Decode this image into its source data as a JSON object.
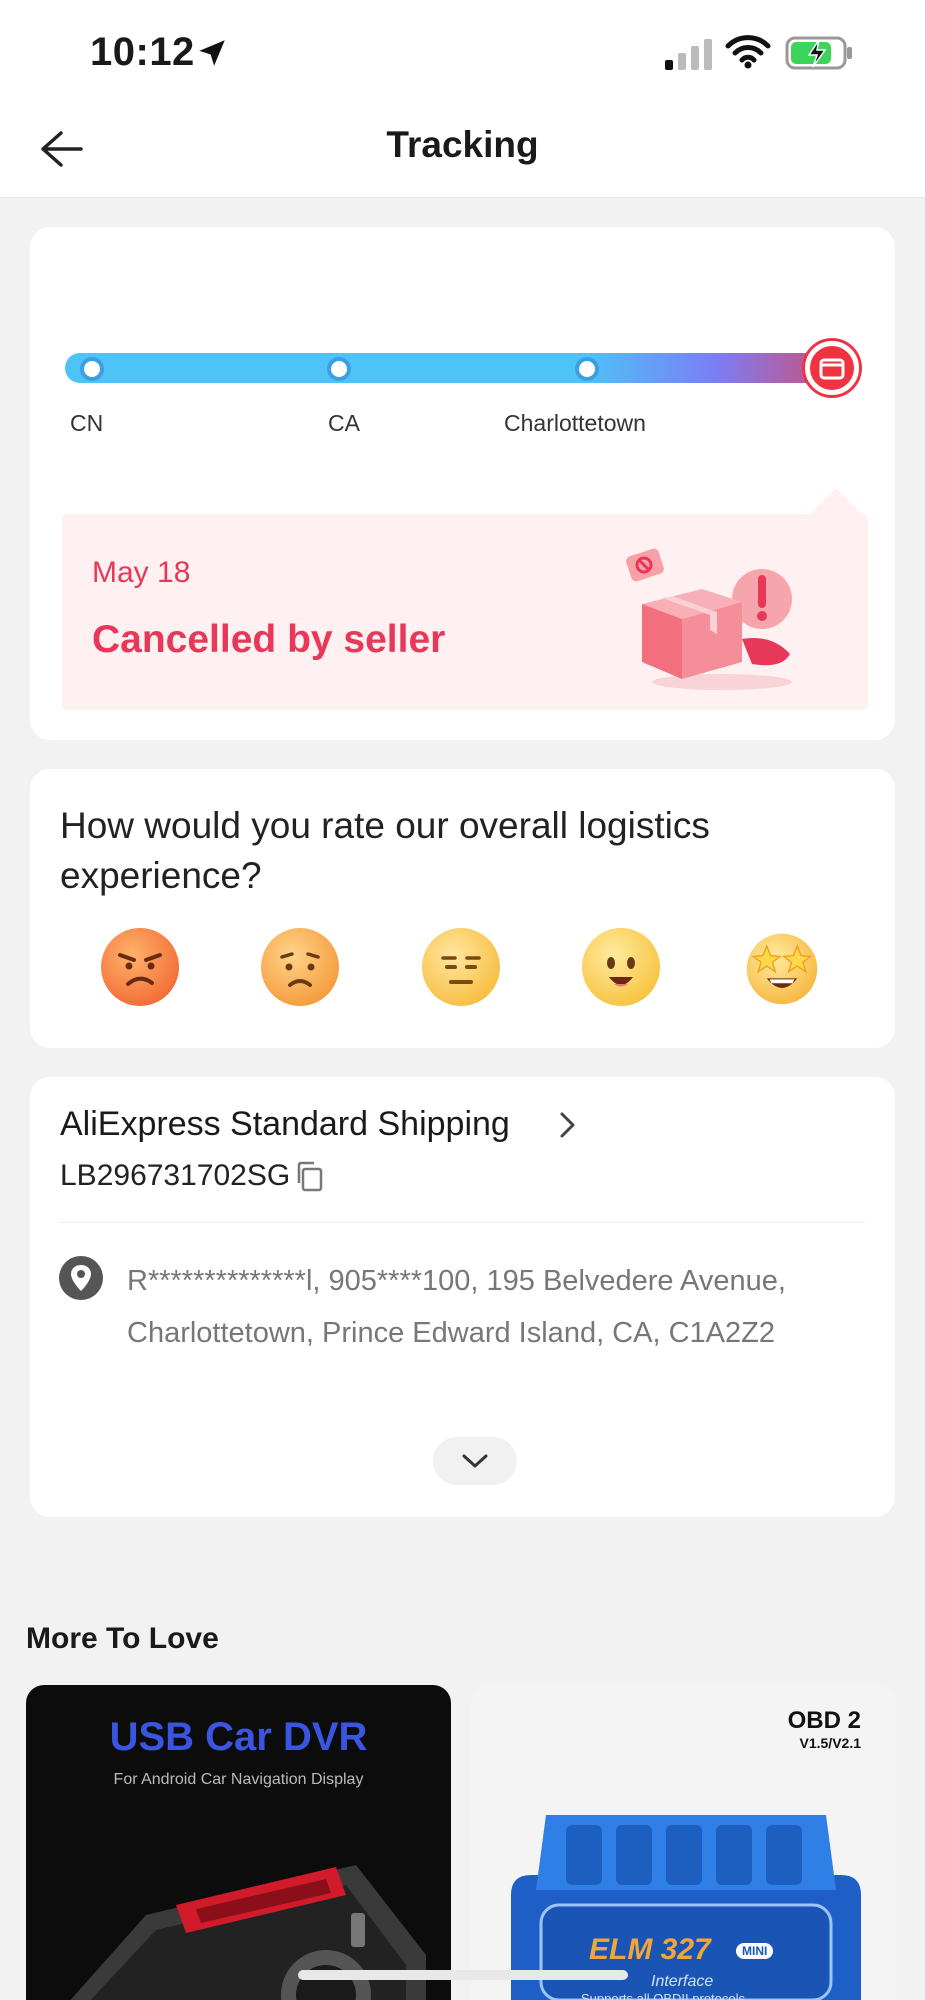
{
  "status_bar": {
    "time": "10:12"
  },
  "nav": {
    "title": "Tracking"
  },
  "tracking": {
    "locations": [
      "CN",
      "CA",
      "Charlottetown"
    ],
    "date": "May 18",
    "status": "Cancelled by seller"
  },
  "rating": {
    "question": "How would you rate our overall logistics experience?",
    "options": [
      "angry",
      "sad",
      "neutral",
      "happy",
      "starstruck"
    ]
  },
  "shipping": {
    "carrier": "AliExpress Standard Shipping",
    "tracking_number": "LB296731702SG",
    "address": "R**************l,  905****100,  195 Belvedere Avenue,  Charlottetown,  Prince Edward Island,  CA,  C1A2Z2"
  },
  "more_to_love": {
    "title": "More To Love",
    "products": [
      {
        "title": "USB Car DVR",
        "subtitle": "For Android Car Navigation Display"
      },
      {
        "title": "OBD 2",
        "subtitle": "V1.5/V2.1",
        "label": "ELM 327",
        "badge": "MINI",
        "caption": "Interface",
        "caption2": "Supports all OBDII protocols"
      }
    ]
  },
  "colors": {
    "accent": "#e8385a",
    "progress": "#4ec3f7",
    "progress_end": "#f0333f"
  }
}
